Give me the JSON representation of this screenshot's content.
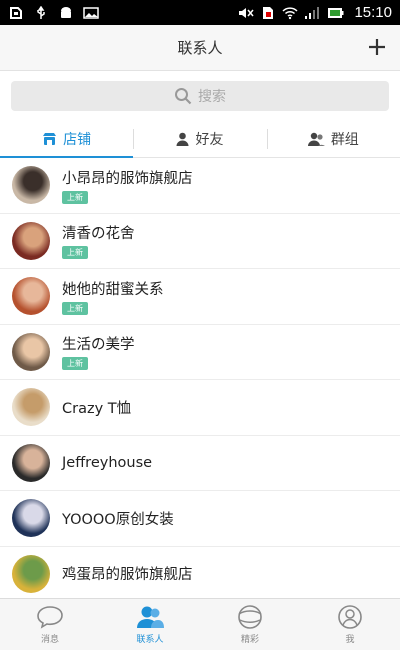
{
  "status_bar": {
    "time": "15:10",
    "icons": [
      "app-icon",
      "usb-icon",
      "android-icon",
      "image-icon",
      "mute-icon",
      "sim-icon",
      "wifi-icon",
      "signal-icon",
      "battery-icon"
    ]
  },
  "header": {
    "title": "联系人",
    "add_icon": "plus-icon"
  },
  "search": {
    "placeholder": "搜索"
  },
  "tabs": [
    {
      "label": "店铺",
      "icon": "shop-icon",
      "active": true
    },
    {
      "label": "好友",
      "icon": "person-icon",
      "active": false
    },
    {
      "label": "群组",
      "icon": "group-icon",
      "active": false
    }
  ],
  "contacts": [
    {
      "name": "小昂昂的服饰旗舰店",
      "badge": "上新",
      "avatar_colors": [
        "#c9b8a6",
        "#3a2f2a"
      ]
    },
    {
      "name": "清香の花舍",
      "badge": "上新",
      "avatar_colors": [
        "#7a2a22",
        "#d9a27c"
      ]
    },
    {
      "name": "她他的甜蜜关系",
      "badge": "上新",
      "avatar_colors": [
        "#b5512e",
        "#e7b79a"
      ]
    },
    {
      "name": "生活の美学",
      "badge": "上新",
      "avatar_colors": [
        "#6f5a48",
        "#e9c6a6"
      ]
    },
    {
      "name": "Crazy T恤",
      "badge": "",
      "avatar_colors": [
        "#e9ddc9",
        "#c59c6a"
      ]
    },
    {
      "name": "Jeffreyhouse",
      "badge": "",
      "avatar_colors": [
        "#2a2a2a",
        "#d8b39a"
      ]
    },
    {
      "name": "YOOOO原创女装",
      "badge": "",
      "avatar_colors": [
        "#1f3258",
        "#d9d9e8"
      ]
    },
    {
      "name": "鸡蛋昂的服饰旗舰店",
      "badge": "",
      "avatar_colors": [
        "#d8b23a",
        "#6d9b4a"
      ]
    }
  ],
  "bottom_nav": [
    {
      "label": "消息",
      "icon": "chat-bubble-icon",
      "active": false
    },
    {
      "label": "联系人",
      "icon": "contacts-icon",
      "active": true
    },
    {
      "label": "精彩",
      "icon": "discover-icon",
      "active": false
    },
    {
      "label": "我",
      "icon": "profile-icon",
      "active": false
    }
  ],
  "colors": {
    "accent": "#1e90d6",
    "badge": "#5ec2a0",
    "status_bar": "#000000"
  }
}
